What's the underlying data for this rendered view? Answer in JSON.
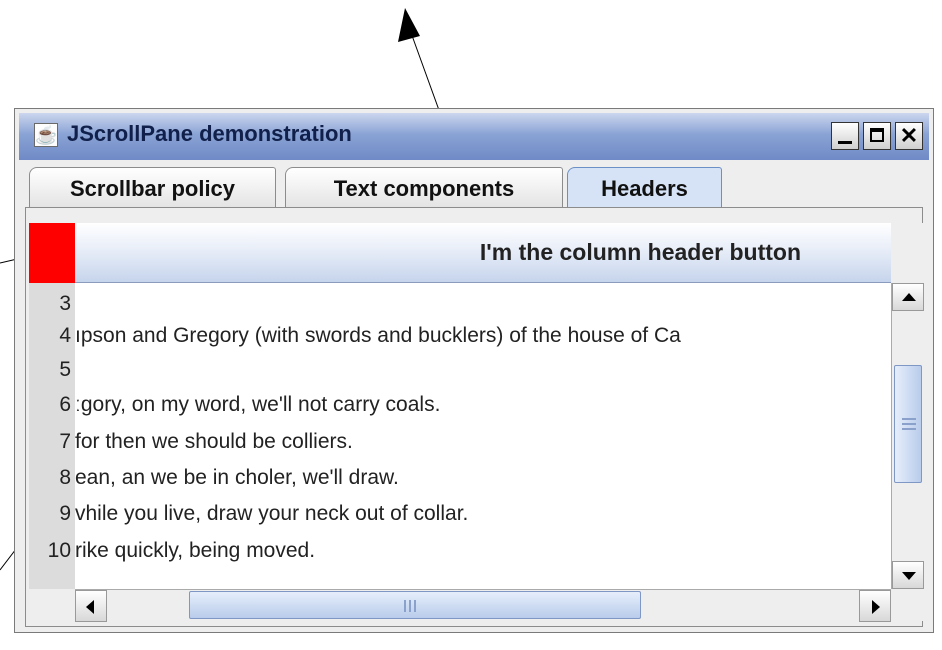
{
  "window": {
    "title": "JScrollPane demonstration",
    "app_icon": "java-cup-icon",
    "controls": {
      "minimize_icon": "minimize-icon",
      "maximize_icon": "maximize-icon",
      "close_glyph": "✕"
    }
  },
  "tabs": [
    {
      "label": "Scrollbar policy",
      "selected": false
    },
    {
      "label": "Text components",
      "selected": false
    },
    {
      "label": "Headers",
      "selected": true
    }
  ],
  "scroll_pane": {
    "column_header_label": "I'm the column header button",
    "upper_left_corner_color": "#ff0000",
    "row_numbers": [
      "3",
      "4",
      "5",
      "6",
      "7",
      "8",
      "9",
      "10"
    ],
    "lines": [
      "",
      "ıpson and Gregory (with swords and bucklers) of the house of Ca",
      "",
      "ːgory, on my word, we'll not carry coals.",
      "for then we should be colliers.",
      "ean, an we be in choler, we'll draw.",
      "vhile you live, draw your neck out of collar.",
      "rike quickly, being moved."
    ]
  },
  "colors": {
    "accent": "#6f8ac6",
    "corner_red": "#ff0000",
    "row_header_bg": "#dcdcdc"
  }
}
